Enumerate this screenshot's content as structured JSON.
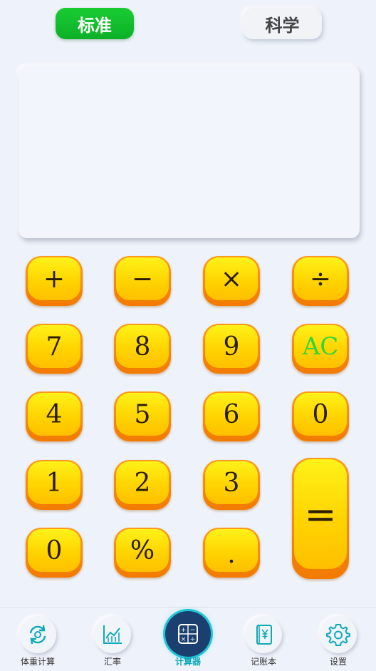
{
  "tabs": {
    "standard": "标准",
    "science": "科学"
  },
  "display": {
    "expression": "",
    "result": ""
  },
  "keys": {
    "plus": "+",
    "minus": "−",
    "multiply": "×",
    "divide": "÷",
    "seven": "7",
    "eight": "8",
    "nine": "9",
    "clear": "AC",
    "four": "4",
    "five": "5",
    "six": "6",
    "zero_right": "0",
    "one": "1",
    "two": "2",
    "three": "3",
    "equals": "=",
    "zero": "0",
    "percent": "%",
    "decimal": "."
  },
  "nav": {
    "items": [
      {
        "label": "体重计算",
        "icon": "refresh-icon"
      },
      {
        "label": "汇率",
        "icon": "chart-icon"
      },
      {
        "label": "计算器",
        "icon": "calculator-icon",
        "active": true
      },
      {
        "label": "记账本",
        "icon": "notebook-yen-icon"
      },
      {
        "label": "设置",
        "icon": "gear-icon"
      }
    ]
  },
  "colors": {
    "active_tab": "#12c02e",
    "key_face": "#ffd400",
    "key_edge": "#f27a00",
    "clear_key_text": "#2fd63a",
    "nav_accent": "#10a9b8"
  }
}
